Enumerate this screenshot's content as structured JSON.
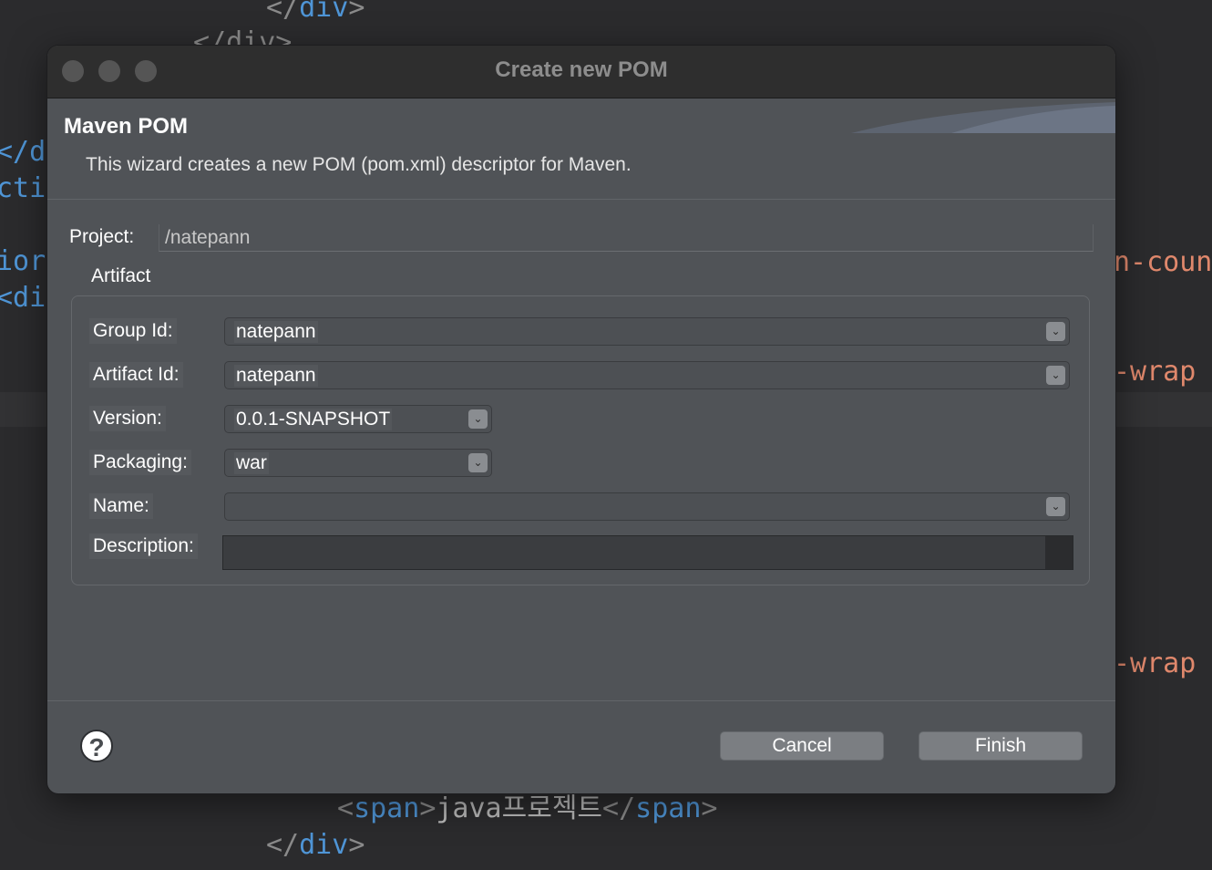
{
  "editor": {
    "top_close_div": "</div>",
    "partial_close_div": "</div>",
    "left_fragments": [
      "</di",
      "ctic",
      "ior",
      "<div"
    ],
    "right_fragments": [
      "n-coun",
      "-wrap",
      "-wrap"
    ],
    "bottom_span_open": "<span>",
    "bottom_span_text": "java프로젝트",
    "bottom_span_close": "</span>",
    "bottom_close_div": "</div>"
  },
  "dialog": {
    "title": "Create new POM",
    "banner_title": "Maven POM",
    "banner_description": "This wizard creates a new POM (pom.xml) descriptor for Maven.",
    "project_label": "Project:",
    "project_value": "/natepann",
    "artifact_group_title": "Artifact",
    "fields": {
      "group_id_label": "Group Id:",
      "group_id_value": "natepann",
      "artifact_id_label": "Artifact Id:",
      "artifact_id_value": "natepann",
      "version_label": "Version:",
      "version_value": "0.0.1-SNAPSHOT",
      "packaging_label": "Packaging:",
      "packaging_value": "war",
      "name_label": "Name:",
      "name_value": "",
      "description_label": "Description:",
      "description_value": ""
    },
    "buttons": {
      "help": "?",
      "cancel": "Cancel",
      "finish": "Finish"
    }
  },
  "colors": {
    "dialog_bg": "#505357",
    "titlebar_bg": "#2e2e2e",
    "editor_bg": "#2b2b2d",
    "tag_blue": "#4f95d6",
    "attr_orange": "#e0886c"
  }
}
